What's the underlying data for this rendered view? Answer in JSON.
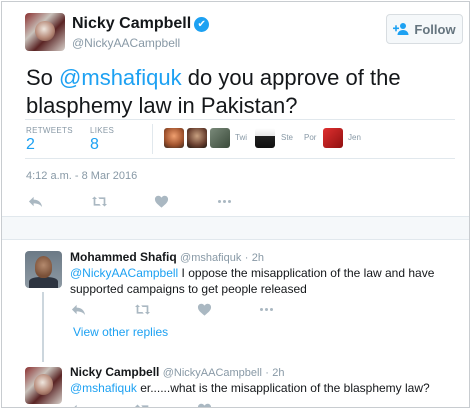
{
  "main_tweet": {
    "author_name": "Nicky Campbell",
    "verified_icon": "✔",
    "author_handle": "@NickyAACampbell",
    "follow_label": "Follow",
    "text_prefix": "So ",
    "mention": "@mshafiquk",
    "text_suffix": " do you approve of the blasphemy law in Pakistan?",
    "retweets_label": "RETWEETS",
    "retweets_count": "2",
    "likes_label": "LIKES",
    "likes_count": "8",
    "likers": [
      "Twi",
      "Ste",
      "Por",
      "Jen"
    ],
    "timestamp": "4:12 a.m. - 8 Mar 2016"
  },
  "replies": [
    {
      "author_name": "Mohammed Shafiq",
      "author_handle": "@mshafiquk",
      "separator": "·",
      "time": "2h",
      "mention": "@NickyAACampbell",
      "text": " I oppose the misapplication of the law and have supported campaigns to get people released",
      "view_other_replies": "View other replies"
    },
    {
      "author_name": "Nicky Campbell",
      "author_handle": "@NickyAACampbell",
      "separator": "·",
      "time": "2h",
      "mention": "@mshafiquk",
      "text": " er......what is the misapplication of the blasphemy law?"
    }
  ],
  "icons": [
    "follow-person-icon",
    "reply-icon",
    "retweet-icon",
    "like-icon",
    "more-icon",
    "verified-icon"
  ],
  "colors": {
    "accent": "#1da1f2",
    "muted": "#8899a6",
    "action": "#aab8c2"
  }
}
